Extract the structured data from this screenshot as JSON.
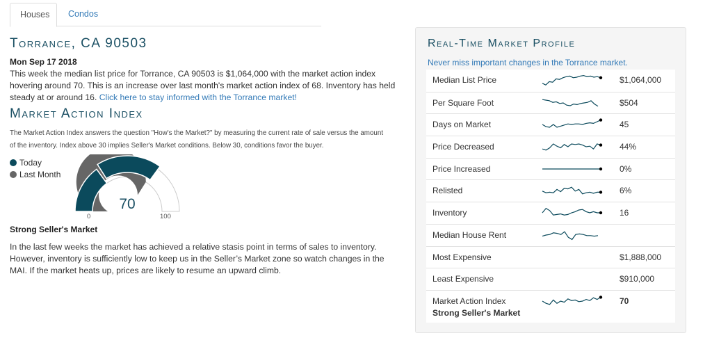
{
  "tabs": [
    {
      "label": "Houses",
      "active": true
    },
    {
      "label": "Condos",
      "active": false
    }
  ],
  "location_title": "Torrance, CA 90503",
  "date": "Mon Sep 17 2018",
  "summary_text": "This week the median list price for Torrance, CA 90503 is $1,064,000 with the market action index hovering around 70. This is an increase over last month's market action index of 68. Inventory has held steady at or around 16. ",
  "summary_link": "Click here to stay informed with the Torrance market!",
  "mai": {
    "title": "Market Action Index",
    "description": "The Market Action Index answers the question \"How's the Market?\" by measuring the current rate of sale versus the amount of the inventory. Index above 30 implies Seller's Market conditions. Below 30, conditions favor the buyer.",
    "legend_today": "Today",
    "legend_last_month": "Last Month",
    "today_value": 70,
    "last_month_value": 68,
    "value_label": "70",
    "min_label": "0",
    "max_label": "100",
    "verdict": "Strong Seller's Market",
    "analysis": "In the last few weeks the market has achieved a relative stasis point in terms of sales to inventory. However, inventory is sufficiently low to keep us in the Seller’s Market zone so watch changes in the MAI. If the market heats up, prices are likely to resume an upward climb."
  },
  "profile": {
    "title": "Real-Time Market Profile",
    "subtitle": "Never miss important changes in the Torrance market.",
    "rows": [
      {
        "label": "Median List Price",
        "value": "$1,064,000",
        "spark": [
          0.2,
          0.05,
          0.35,
          0.3,
          0.6,
          0.55,
          0.7,
          0.8,
          0.85,
          0.7,
          0.75,
          0.85,
          0.9,
          0.8,
          0.85,
          0.75,
          0.8,
          0.7
        ],
        "dot": true
      },
      {
        "label": "Per Square Foot",
        "value": "$504",
        "spark": [
          0.8,
          0.75,
          0.7,
          0.55,
          0.6,
          0.45,
          0.5,
          0.3,
          0.25,
          0.4,
          0.35,
          0.45,
          0.5,
          0.55,
          0.7,
          0.4,
          0.2
        ],
        "dot": false
      },
      {
        "label": "Days on Market",
        "value": "45",
        "spark": [
          0.5,
          0.3,
          0.25,
          0.5,
          0.25,
          0.35,
          0.45,
          0.55,
          0.5,
          0.55,
          0.55,
          0.5,
          0.6,
          0.65,
          0.6,
          0.75,
          0.9
        ],
        "dot": true
      },
      {
        "label": "Price Decreased",
        "value": "44%",
        "spark": [
          0.3,
          0.2,
          0.4,
          0.75,
          0.55,
          0.4,
          0.7,
          0.5,
          0.75,
          0.7,
          0.75,
          0.65,
          0.5,
          0.55,
          0.3,
          0.75,
          0.65
        ],
        "dot": true
      },
      {
        "label": "Price Increased",
        "value": "0%",
        "spark": [
          0.5,
          0.5,
          0.5,
          0.5,
          0.5,
          0.5,
          0.5,
          0.5,
          0.5,
          0.5,
          0.5,
          0.5,
          0.5,
          0.5,
          0.5,
          0.5,
          0.5
        ],
        "dot": true
      },
      {
        "label": "Relisted",
        "value": "6%",
        "spark": [
          0.45,
          0.3,
          0.35,
          0.3,
          0.6,
          0.4,
          0.7,
          0.65,
          0.8,
          0.45,
          0.6,
          0.2,
          0.3,
          0.35,
          0.25,
          0.35,
          0.35
        ],
        "dot": true
      },
      {
        "label": "Inventory",
        "value": "16",
        "spark": [
          0.5,
          0.9,
          0.7,
          0.3,
          0.35,
          0.4,
          0.3,
          0.35,
          0.5,
          0.6,
          0.75,
          0.8,
          0.6,
          0.5,
          0.6,
          0.5,
          0.5
        ],
        "dot": true
      },
      {
        "label": "Median House Rent",
        "value": "",
        "spark": [
          0.4,
          0.5,
          0.55,
          0.7,
          0.65,
          0.55,
          0.8,
          0.3,
          0.1,
          0.55,
          0.6,
          0.55,
          0.45,
          0.45,
          0.4,
          0.45
        ],
        "dot": false
      },
      {
        "label": "Most Expensive",
        "value": "$1,888,000",
        "spark": [],
        "dot": false
      },
      {
        "label": "Least Expensive",
        "value": "$910,000",
        "spark": [],
        "dot": false
      },
      {
        "label": "Market Action Index",
        "sub": "Strong Seller's Market",
        "value": "70",
        "spark": [
          0.5,
          0.3,
          0.2,
          0.6,
          0.3,
          0.5,
          0.4,
          0.7,
          0.55,
          0.6,
          0.45,
          0.5,
          0.65,
          0.55,
          0.8,
          0.65,
          0.85
        ],
        "dot": true,
        "bold": true
      }
    ]
  },
  "colors": {
    "accent": "#0b4a5c",
    "last_month": "#666666",
    "link": "#337ab7",
    "gauge_track": "#dddddd"
  }
}
